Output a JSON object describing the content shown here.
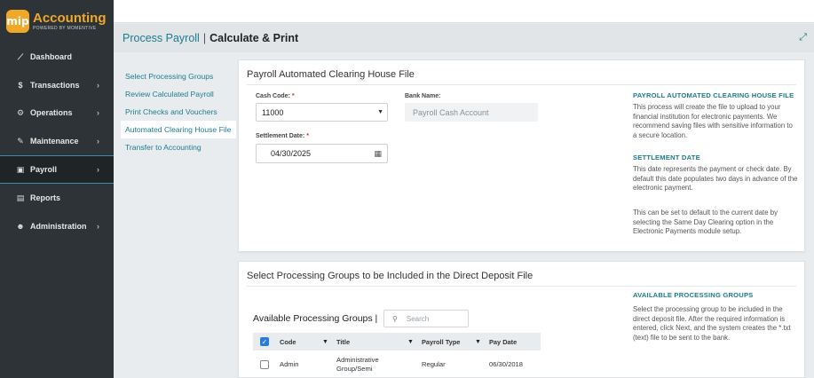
{
  "brand": {
    "badge": "mip",
    "title": "Accounting",
    "subtitle": "POWERED BY MOMENTIVE"
  },
  "nav": [
    {
      "label": "Dashboard",
      "icon": "chart-line-icon",
      "glyph": "⟋",
      "chevron": false,
      "active": false
    },
    {
      "label": "Transactions",
      "icon": "dollar-icon",
      "glyph": "$",
      "chevron": true,
      "active": false
    },
    {
      "label": "Operations",
      "icon": "cogs-icon",
      "glyph": "⚙",
      "chevron": true,
      "active": false
    },
    {
      "label": "Maintenance",
      "icon": "wrench-icon",
      "glyph": "✎",
      "chevron": true,
      "active": false
    },
    {
      "label": "Payroll",
      "icon": "money-icon",
      "glyph": "▣",
      "chevron": true,
      "active": true
    },
    {
      "label": "Reports",
      "icon": "file-icon",
      "glyph": "▤",
      "chevron": false,
      "active": false
    },
    {
      "label": "Administration",
      "icon": "users-icon",
      "glyph": "☻",
      "chevron": true,
      "active": false
    }
  ],
  "header": {
    "section": "Process Payroll",
    "separator": "|",
    "current": "Calculate & Print"
  },
  "steps": [
    {
      "label": "Select Processing Groups",
      "active": false
    },
    {
      "label": "Review Calculated Payroll",
      "active": false
    },
    {
      "label": "Print Checks and Vouchers",
      "active": false
    },
    {
      "label": "Automated Clearing House File",
      "active": true
    },
    {
      "label": "Transfer to Accounting",
      "active": false
    }
  ],
  "ach": {
    "title": "Payroll Automated Clearing House File",
    "cash_code_label": "Cash Code:",
    "cash_code_value": "11000",
    "bank_name_label": "Bank Name:",
    "bank_name_value": "Payroll Cash Account",
    "settlement_label": "Settlement Date:",
    "settlement_value": "04/30/2025",
    "required_mark": "*",
    "help1_title": "PAYROLL AUTOMATED CLEARING HOUSE FILE",
    "help1_text": "This process will create the file to upload to your financial institution for electronic payments. We recommend saving files with sensitive information to a secure location.",
    "help2_title": "SETTLEMENT DATE",
    "help2_text": "This date represents the payment or check date. By default this date populates two days in advance of the electronic payment.",
    "help3_text": "This can be set to default to the current date by selecting the Same Day Clearing option in the Electronic Payments module setup."
  },
  "groups": {
    "title": "Select Processing Groups to be Included in the Direct Deposit File",
    "list_title": "Available Processing Groups |",
    "search_placeholder": "Search",
    "help_title": "AVAILABLE PROCESSING GROUPS",
    "help_text": "Select the processing group to be included in the direct deposit file. After the required information is entered, click Next, and the system creates the *.txt (text) file to be sent to the bank.",
    "columns": [
      "Code",
      "Title",
      "Payroll Type",
      "Pay Date"
    ],
    "rows": [
      {
        "code": "Admin",
        "title": "Administrative Group/Semi",
        "type": "Regular",
        "date": "06/30/2018"
      }
    ]
  }
}
